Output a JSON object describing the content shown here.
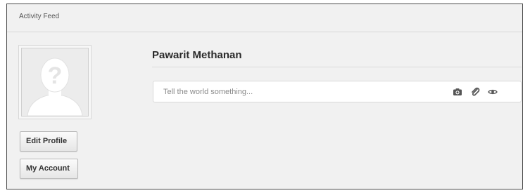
{
  "feed": {
    "title": "Activity Feed"
  },
  "profile": {
    "name": "Pawarit Methanan",
    "avatar_icon": "default-user-silhouette-icon",
    "edit_profile_label": "Edit Profile",
    "my_account_label": "My Account"
  },
  "status": {
    "placeholder": "Tell the world something...",
    "value": "",
    "icons": [
      "camera-icon",
      "attachment-icon",
      "eye-icon"
    ]
  },
  "colors": {
    "panel_background": "#f1f1f1",
    "panel_border": "#4a4a4a",
    "input_background": "#ffffff",
    "icon_color": "#555555"
  }
}
